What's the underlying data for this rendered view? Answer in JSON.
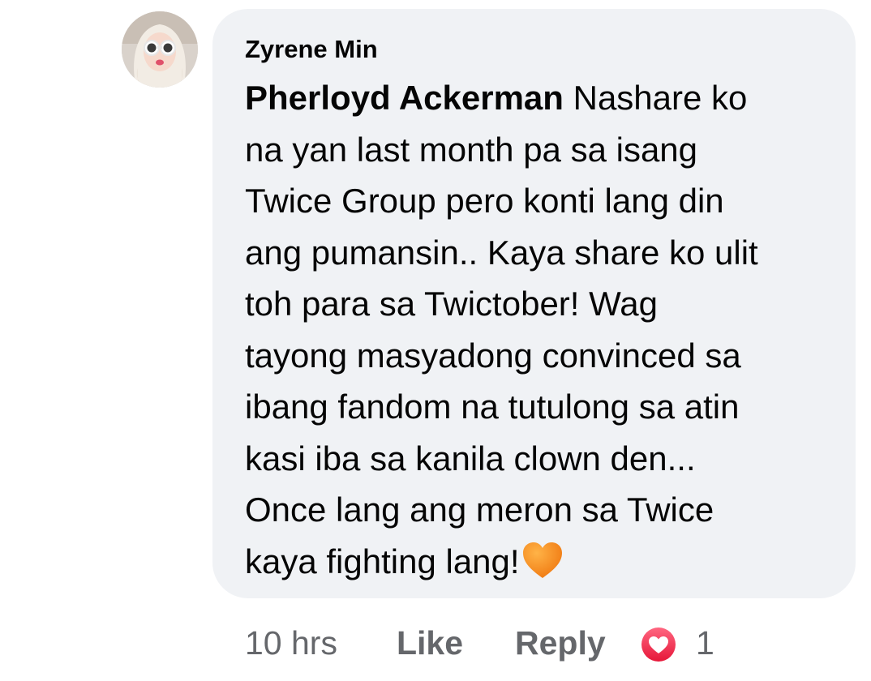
{
  "comment": {
    "author": "Zyrene Min",
    "mention": "Pherloyd Ackerman",
    "lines": [
      " Nashare ko",
      "na yan last month pa sa isang",
      "Twice Group pero konti lang din",
      "ang pumansin.. Kaya share ko ulit",
      "toh para sa Twictober! Wag",
      "tayong masyadong convinced sa",
      "ibang fandom na tutulong sa atin",
      "kasi iba sa kanila clown den...",
      "Once lang ang meron sa Twice",
      "kaya fighting lang!"
    ],
    "emoji": "orange-heart-icon"
  },
  "actions": {
    "timestamp": "10 hrs",
    "like_label": "Like",
    "reply_label": "Reply",
    "reaction_icon": "heart-reaction-icon",
    "reaction_count": "1"
  },
  "colors": {
    "bubble": "#f0f2f5",
    "text": "#050505",
    "secondary": "#65676b",
    "heart_reaction": "#f33e58",
    "orange_heart": "#f7871c"
  }
}
